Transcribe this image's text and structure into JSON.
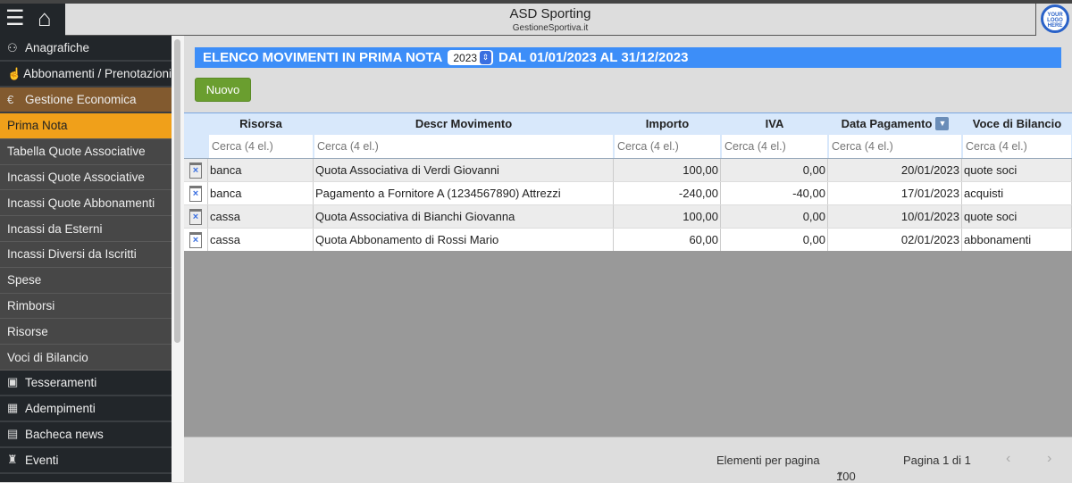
{
  "app": {
    "title": "ASD Sporting",
    "subtitle": "GestioneSportiva.it",
    "logo_text": "YOUR LOGO HERE"
  },
  "sidebar": {
    "items": [
      {
        "label": "Anagrafiche",
        "icon": "users-icon",
        "type": "main"
      },
      {
        "label": "Abbonamenti / Prenotazioni",
        "icon": "hand-pointer-icon",
        "type": "main"
      },
      {
        "label": "Gestione Economica",
        "icon": "euro-icon",
        "type": "section"
      },
      {
        "label": "Prima Nota",
        "type": "active"
      },
      {
        "label": "Tabella Quote Associative",
        "type": "sub"
      },
      {
        "label": "Incassi Quote Associative",
        "type": "sub"
      },
      {
        "label": "Incassi Quote Abbonamenti",
        "type": "sub"
      },
      {
        "label": "Incassi da Esterni",
        "type": "sub"
      },
      {
        "label": "Incassi Diversi da Iscritti",
        "type": "sub"
      },
      {
        "label": "Spese",
        "type": "sub"
      },
      {
        "label": "Rimborsi",
        "type": "sub"
      },
      {
        "label": "Risorse",
        "type": "sub"
      },
      {
        "label": "Voci di Bilancio",
        "type": "sub"
      },
      {
        "label": "Tesseramenti",
        "icon": "id-card-icon",
        "type": "main"
      },
      {
        "label": "Adempimenti",
        "icon": "calendar-icon",
        "type": "main"
      },
      {
        "label": "Bacheca news",
        "icon": "newspaper-icon",
        "type": "main"
      },
      {
        "label": "Eventi",
        "icon": "trophy-icon",
        "type": "main"
      }
    ]
  },
  "header": {
    "title": "ELENCO MOVIMENTI IN PRIMA NOTA",
    "year": "2023",
    "range": "DAL 01/01/2023 AL 31/12/2023"
  },
  "toolbar": {
    "new_label": "Nuovo"
  },
  "table": {
    "columns": [
      "Risorsa",
      "Descr Movimento",
      "Importo",
      "IVA",
      "Data Pagamento",
      "Voce di Bilancio"
    ],
    "filter_placeholder": "Cerca (4 el.)",
    "rows": [
      [
        "banca",
        "Quota Associativa di Verdi Giovanni",
        "100,00",
        "0,00",
        "20/01/2023",
        "quote soci"
      ],
      [
        "banca",
        "Pagamento a Fornitore A (1234567890) Attrezzi",
        "-240,00",
        "-40,00",
        "17/01/2023",
        "acquisti"
      ],
      [
        "cassa",
        "Quota Associativa di Bianchi Giovanna",
        "100,00",
        "0,00",
        "10/01/2023",
        "quote soci"
      ],
      [
        "cassa",
        "Quota Abbonamento di Rossi Mario",
        "60,00",
        "0,00",
        "02/01/2023",
        "abbonamenti"
      ]
    ]
  },
  "pagination": {
    "per_page_label": "Elementi per pagina",
    "per_page": "100",
    "page_label": "Pagina 1 di 1"
  },
  "colors": {
    "header_blue": "#3d8ef8",
    "active_orange": "#f0a01a",
    "section_brown": "#825a2f",
    "new_green": "#6a9e2f"
  }
}
